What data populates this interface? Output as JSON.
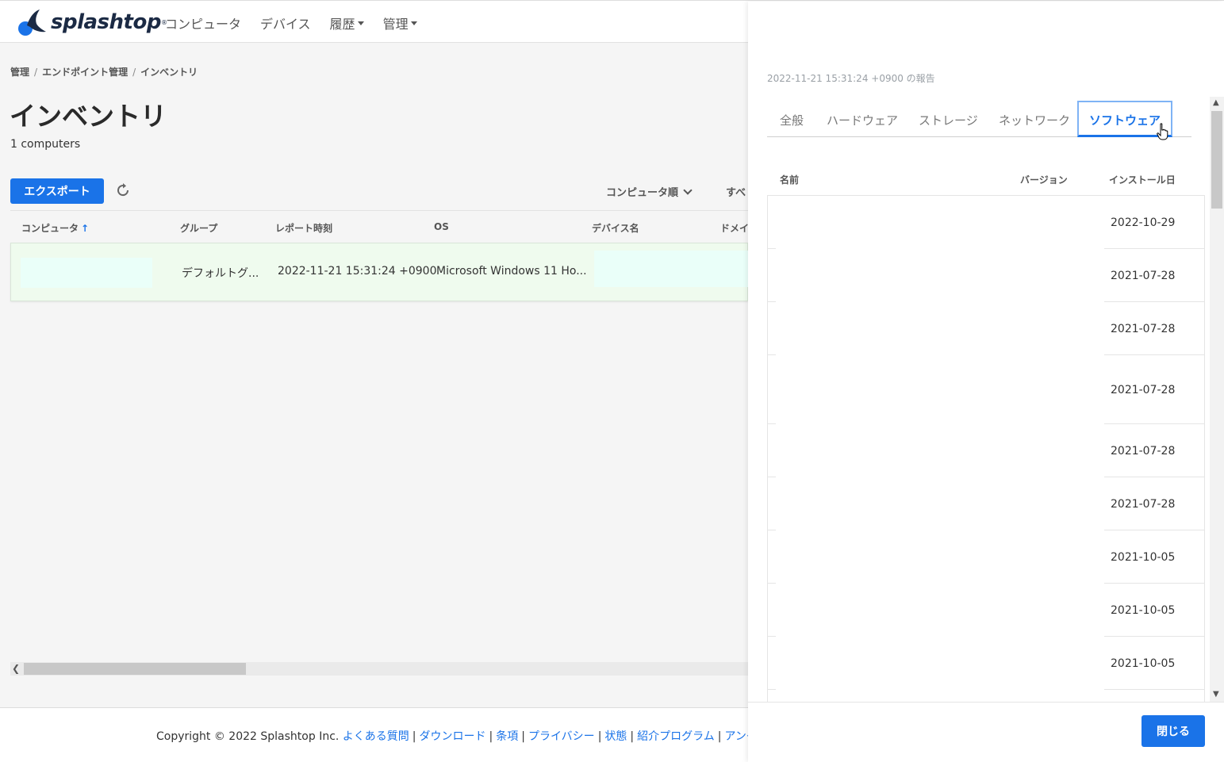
{
  "brand": {
    "name": "splashtop",
    "reg": "®",
    "color": "#1b2a44",
    "accent": "#1a73e8"
  },
  "nav": {
    "items": [
      {
        "label": "コンピュータ",
        "dropdown": false
      },
      {
        "label": "デバイス",
        "dropdown": false
      },
      {
        "label": "履歴",
        "dropdown": true
      },
      {
        "label": "管理",
        "dropdown": true
      }
    ]
  },
  "breadcrumb": [
    "管理",
    "エンドポイント管理",
    "インベントリ"
  ],
  "page": {
    "title": "インベントリ",
    "count": "1 computers",
    "export_label": "エクスポート",
    "refresh_icon": "refresh-icon",
    "sort_label": "コンピュータ順",
    "filter_label_cut": "すべ"
  },
  "table": {
    "headers": [
      "コンピュータ",
      "グループ",
      "レポート時刻",
      "OS",
      "デバイス名",
      "ドメイ"
    ],
    "sort_indicator": "↑",
    "rows": [
      {
        "computer": "",
        "group": "デフォルトグ...",
        "report_time": "2022-11-21 15:31:24 +0900",
        "os": "Microsoft Windows 11 Ho...",
        "device_name": ""
      }
    ]
  },
  "footer": {
    "copyright": "Copyright © 2022 Splashtop Inc.",
    "links": [
      "よくある質問",
      "ダウンロード",
      "条項",
      "プライバシー",
      "状態",
      "紹介プログラム",
      "アンケ"
    ]
  },
  "panel": {
    "report_time": "2022-11-21 15:31:24 +0900 の報告",
    "tabs": [
      {
        "label": "全般",
        "active": false
      },
      {
        "label": "ハードウェア",
        "active": false
      },
      {
        "label": "ストレージ",
        "active": false
      },
      {
        "label": "ネットワーク",
        "active": false
      },
      {
        "label": "ソフトウェア",
        "active": true
      }
    ],
    "software": {
      "headers": {
        "name": "名前",
        "version": "バージョン",
        "install_date": "インストール日"
      },
      "rows": [
        {
          "name": "",
          "version": "",
          "install_date": "2022-10-29"
        },
        {
          "name": "",
          "version": "",
          "install_date": "2021-07-28"
        },
        {
          "name": "",
          "version": "",
          "install_date": "2021-07-28"
        },
        {
          "name": "",
          "version": "",
          "install_date": "2021-07-28"
        },
        {
          "name": "",
          "version": "",
          "install_date": "2021-07-28"
        },
        {
          "name": "",
          "version": "",
          "install_date": "2021-07-28"
        },
        {
          "name": "",
          "version": "",
          "install_date": "2021-10-05"
        },
        {
          "name": "",
          "version": "",
          "install_date": "2021-10-05"
        },
        {
          "name": "",
          "version": "",
          "install_date": "2021-10-05"
        }
      ]
    },
    "close_label": "閉じる"
  }
}
